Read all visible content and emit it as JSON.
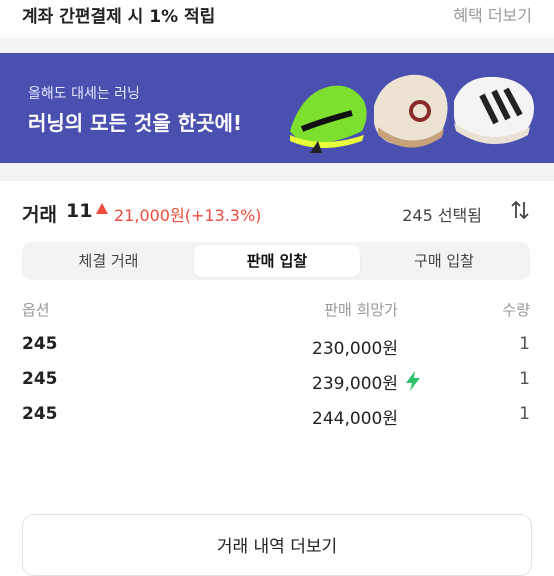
{
  "top_bar": {
    "promo": "계좌 간편결제 시 1% 적립",
    "more": "혜택 더보기"
  },
  "banner": {
    "subtitle": "올해도 대세는 러닝",
    "title": "러닝의 모든 것을 한곳에!"
  },
  "trade": {
    "label": "거래",
    "count": "11",
    "change": "21,000원(+13.3%)",
    "selected": "245 선택됨"
  },
  "tabs": [
    {
      "label": "체결 거래",
      "active": false
    },
    {
      "label": "판매 입찰",
      "active": true
    },
    {
      "label": "구매 입찰",
      "active": false
    }
  ],
  "table": {
    "headers": {
      "option": "옵션",
      "price": "판매 희망가",
      "qty": "수량"
    },
    "rows": [
      {
        "size": "245",
        "price": "230,000원",
        "qty": "1",
        "fast": false
      },
      {
        "size": "245",
        "price": "239,000원",
        "qty": "1",
        "fast": true
      },
      {
        "size": "245",
        "price": "244,000원",
        "qty": "1",
        "fast": false
      }
    ]
  },
  "more_button": "거래 내역 더보기",
  "icons": [
    "up-triangle-icon",
    "sort-arrows-icon",
    "lightning-icon"
  ],
  "colors": {
    "banner": "#4a50b0",
    "up": "#ef4b3e",
    "bolt": "#2fc16b"
  }
}
